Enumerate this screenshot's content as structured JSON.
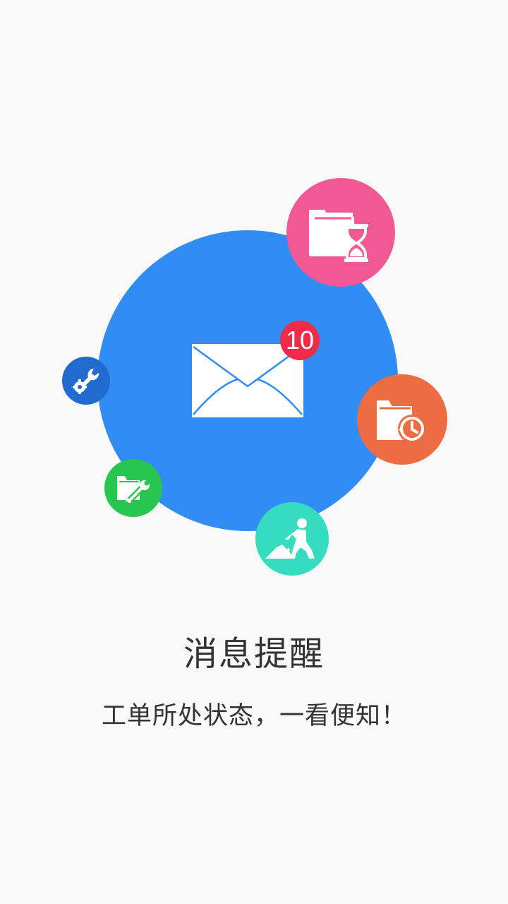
{
  "colors": {
    "background": "#f9f9f9",
    "main_circle": "#318cf4",
    "pending_circle": "#f25894",
    "history_circle": "#ee6c42",
    "worker_circle": "#36dcbe",
    "repair_circle": "#27c74f",
    "settings_circle": "#216bcf",
    "badge": "#ef2b49",
    "text": "#333333"
  },
  "icons": {
    "main": "envelope-icon",
    "pending": "folder-hourglass-icon",
    "history": "folder-history-icon",
    "worker": "worker-digging-icon",
    "repair": "folder-wrench-icon",
    "settings": "wrench-gear-icon"
  },
  "message_badge": {
    "count": "10"
  },
  "content": {
    "title": "消息提醒",
    "subtitle": "工单所处状态，一看便知！"
  }
}
